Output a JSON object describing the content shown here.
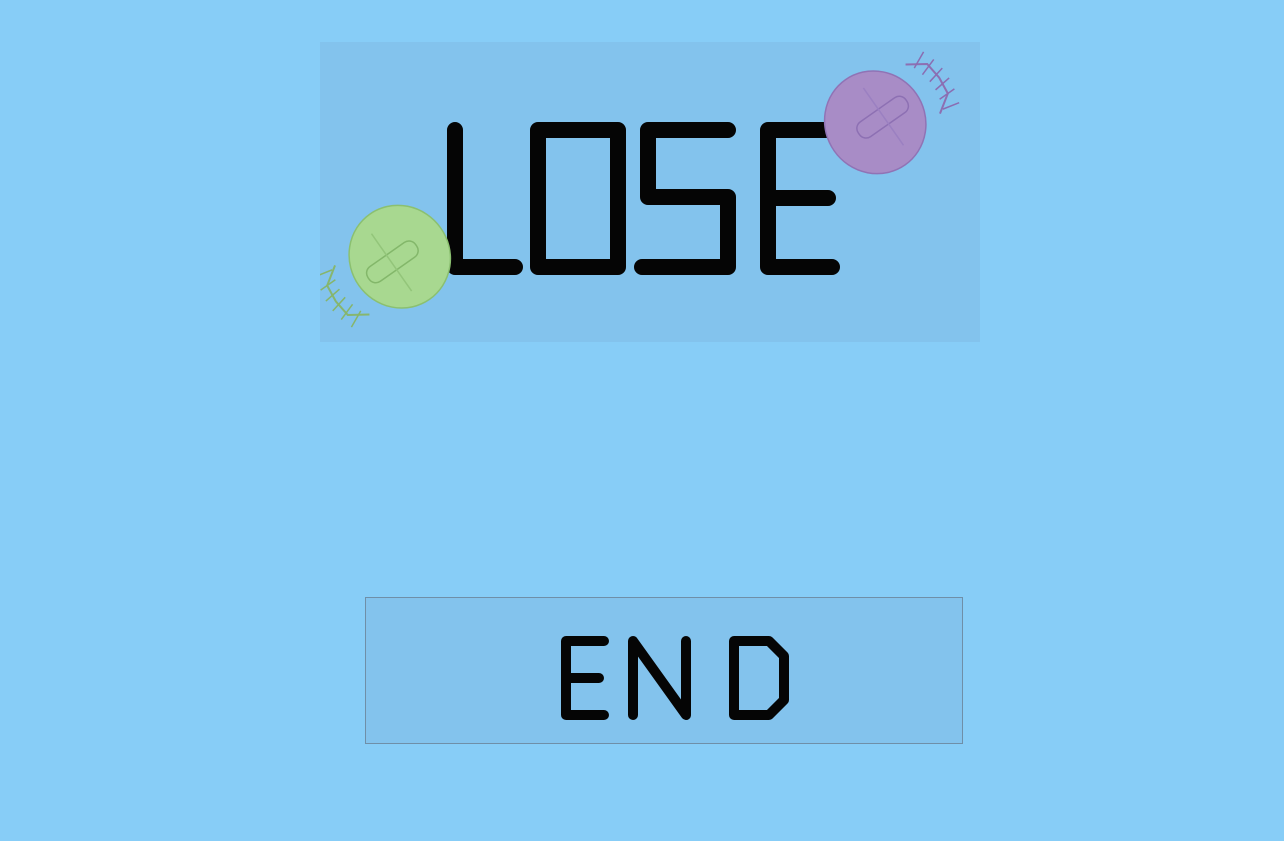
{
  "screen": {
    "title": "LOSE",
    "end_button_label": "END"
  },
  "colors": {
    "background": "#87cdf7",
    "panel": "#83c3ed",
    "text": "#050505",
    "green_creature": "#a8d890",
    "purple_creature": "#a88cc6"
  },
  "icons": {
    "left_creature": "green-trilobite-icon",
    "right_creature": "purple-trilobite-icon"
  }
}
